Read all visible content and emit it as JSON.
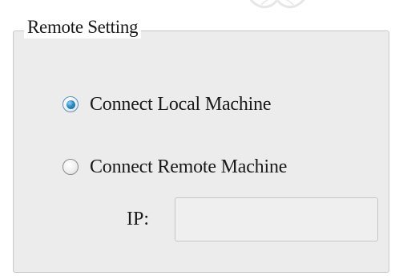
{
  "group": {
    "title": "Remote Setting"
  },
  "radios": {
    "local": {
      "label": "Connect Local Machine",
      "selected": true
    },
    "remote": {
      "label": "Connect Remote Machine",
      "selected": false
    }
  },
  "ip": {
    "label": "IP:",
    "value": "",
    "enabled": false
  },
  "colors": {
    "panel_background": "#ececec",
    "selected_radio": "#2e8bc7"
  },
  "icons": {
    "watermark": "emblem-watermark-icon"
  }
}
